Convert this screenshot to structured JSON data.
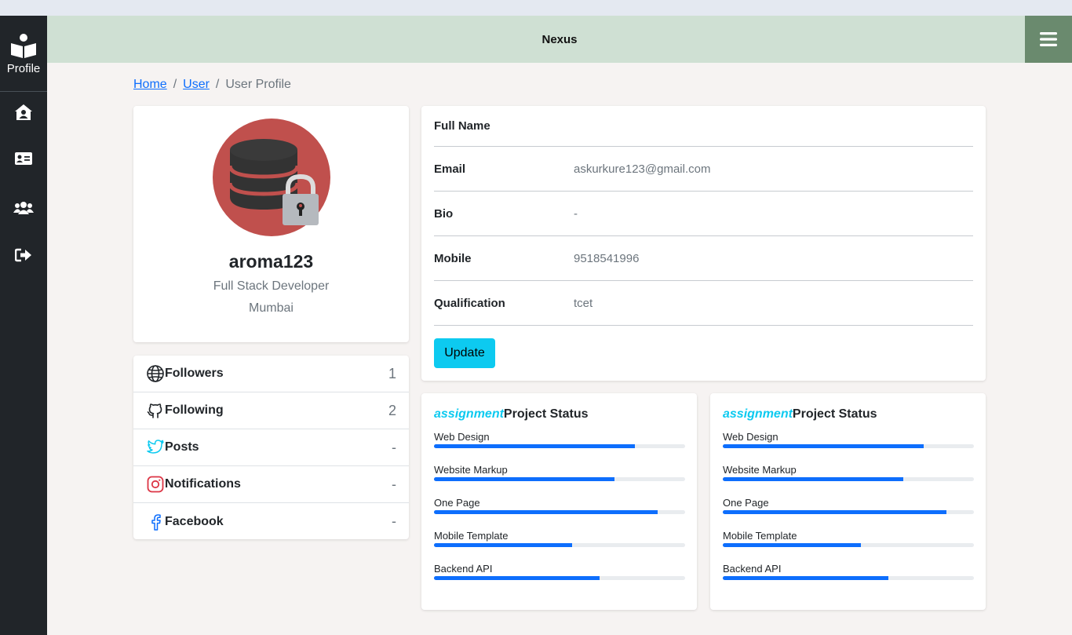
{
  "sidebar": {
    "brand_label": "Profile",
    "items": [
      {
        "icon": "home-user-icon"
      },
      {
        "icon": "id-card-icon"
      },
      {
        "icon": "users-icon"
      },
      {
        "icon": "logout-icon"
      }
    ]
  },
  "header": {
    "title": "Nexus"
  },
  "breadcrumb": {
    "home": "Home",
    "user": "User",
    "current": "User Profile",
    "sep": "/"
  },
  "profile": {
    "username": "aroma123",
    "role": "Full Stack Developer",
    "location": "Mumbai"
  },
  "social": [
    {
      "label": "Followers",
      "value": "1",
      "icon": "globe-icon"
    },
    {
      "label": "Following",
      "value": "2",
      "icon": "github-icon"
    },
    {
      "label": "Posts",
      "value": "-",
      "icon": "twitter-icon"
    },
    {
      "label": "Notifications",
      "value": "-",
      "icon": "instagram-icon"
    },
    {
      "label": "Facebook",
      "value": "-",
      "icon": "facebook-icon"
    }
  ],
  "info": {
    "rows": [
      {
        "label": "Full Name",
        "value": ""
      },
      {
        "label": "Email",
        "value": "askurkure123@gmail.com"
      },
      {
        "label": "Bio",
        "value": "-"
      },
      {
        "label": "Mobile",
        "value": "9518541996"
      },
      {
        "label": "Qualification",
        "value": "tcet"
      }
    ],
    "update_label": "Update"
  },
  "projects": [
    {
      "accent": "assignment",
      "title": "Project Status",
      "items": [
        {
          "label": "Web Design",
          "progress": 80
        },
        {
          "label": "Website Markup",
          "progress": 72
        },
        {
          "label": "One Page",
          "progress": 89
        },
        {
          "label": "Mobile Template",
          "progress": 55
        },
        {
          "label": "Backend API",
          "progress": 66
        }
      ]
    },
    {
      "accent": "assignment",
      "title": "Project Status",
      "items": [
        {
          "label": "Web Design",
          "progress": 80
        },
        {
          "label": "Website Markup",
          "progress": 72
        },
        {
          "label": "One Page",
          "progress": 89
        },
        {
          "label": "Mobile Template",
          "progress": 55
        },
        {
          "label": "Backend API",
          "progress": 66
        }
      ]
    }
  ],
  "colors": {
    "sidebar_bg": "#212529",
    "topbar_bg": "#cfe0d3",
    "menu_btn_bg": "#6a8a6e",
    "accent": "#0dcaf0",
    "progress": "#0d6efd",
    "avatar_bg": "#c0504d"
  }
}
